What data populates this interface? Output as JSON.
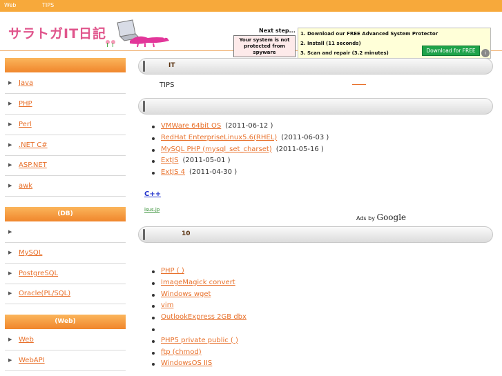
{
  "topbar": {
    "items": [
      "Web",
      "TIPS"
    ]
  },
  "header": {
    "logo_text": "サラトガIT日記"
  },
  "ad": {
    "title": "Next step...",
    "warning": "Your system is not protected from spyware",
    "steps": [
      "1. Download our FREE Advanced System Protector",
      "2. Install (11 seconds)",
      "3. Scan and repair (3.2 minutes)"
    ],
    "button": "Download for FREE",
    "info": "i"
  },
  "sidebar": {
    "section1": {
      "title": "",
      "items": [
        "Java",
        "PHP",
        "Perl",
        ".NET C#",
        "ASP.NET",
        "awk"
      ]
    },
    "section2": {
      "title": "(DB)",
      "items": [
        "",
        "MySQL",
        "PostgreSQL",
        "Oracle(PL/SQL)"
      ]
    },
    "section3": {
      "title": "(Web)",
      "items": [
        "Web",
        "WebAPI"
      ]
    }
  },
  "main": {
    "bar1_title": "IT",
    "tips_text": "TIPS",
    "bar2_title": "",
    "recent": [
      {
        "title": "VMWare 64bit OS",
        "date": "(2011-06-12 )"
      },
      {
        "title": "RedHat EnterpriseLinux5.6(RHEL)",
        "date": "(2011-06-03 )"
      },
      {
        "title": "MySQL PHP (mysql_set_charset)",
        "date": "(2011-05-16 )"
      },
      {
        "title": "ExtJS",
        "date": "(2011-05-01 )"
      },
      {
        "title": "ExtJS 4",
        "date": "(2011-04-30 )"
      }
    ],
    "cpp_link": "C++",
    "isus_link": "isus.jp",
    "ads_by": "Ads by",
    "google": "Google",
    "bar3_title": "10",
    "popular": [
      "PHP ( )",
      "ImageMagick convert",
      "Windows wget",
      "vim",
      "OutlookExpress 2GB dbx",
      "",
      "PHP5 private public ( )",
      "ftp (chmod)",
      "WindowsOS IIS"
    ]
  },
  "colors": {
    "accent": "#f7a93b",
    "link": "#e8702a",
    "logo": "#e0558c"
  }
}
